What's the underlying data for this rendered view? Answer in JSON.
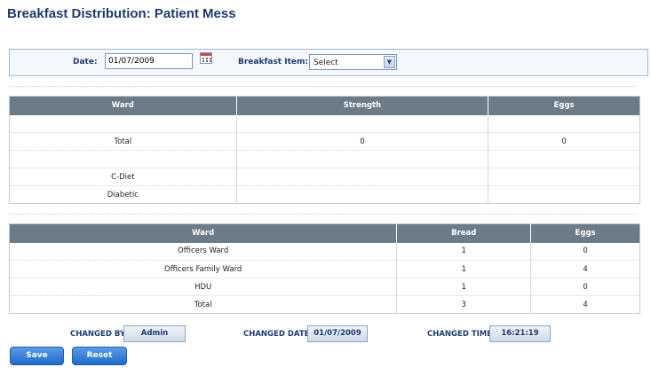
{
  "page": {
    "title": "Breakfast Distribution: Patient Mess"
  },
  "filters": {
    "date_label": "Date:",
    "date_value": "01/07/2009",
    "item_label": "Breakfast Item:",
    "item_selected": "Select"
  },
  "strength_table": {
    "headers": [
      "Ward",
      "Strength",
      "Eggs"
    ],
    "rows": [
      [
        "",
        "",
        ""
      ],
      [
        "Total",
        "0",
        "0"
      ],
      [
        "",
        "",
        ""
      ],
      [
        "C-Diet",
        "",
        ""
      ],
      [
        "Diabetic",
        "",
        ""
      ]
    ]
  },
  "bread_table": {
    "headers": [
      "Ward",
      "Bread",
      "Eggs"
    ],
    "rows": [
      [
        "Officers Ward",
        "1",
        "0"
      ],
      [
        "Officers Family Ward",
        "1",
        "4"
      ],
      [
        "HDU",
        "1",
        "0"
      ],
      [
        "Total",
        "3",
        "4"
      ]
    ]
  },
  "footer": {
    "changed_by_label": "CHANGED BY",
    "changed_by_value": "Admin",
    "changed_date_label": "CHANGED DATE",
    "changed_date_value": "01/07/2009",
    "changed_time_label": "CHANGED TIME",
    "changed_time_value": "16:21:19"
  },
  "actions": {
    "save_label": "Save",
    "reset_label": "Reset"
  },
  "colors": {
    "header_bg": "#6c7b88",
    "title": "#1f3a6b",
    "button": "#1f6cc9"
  },
  "icons": {
    "calendar": "calendar-icon",
    "dropdown": "chevron-down-icon"
  }
}
